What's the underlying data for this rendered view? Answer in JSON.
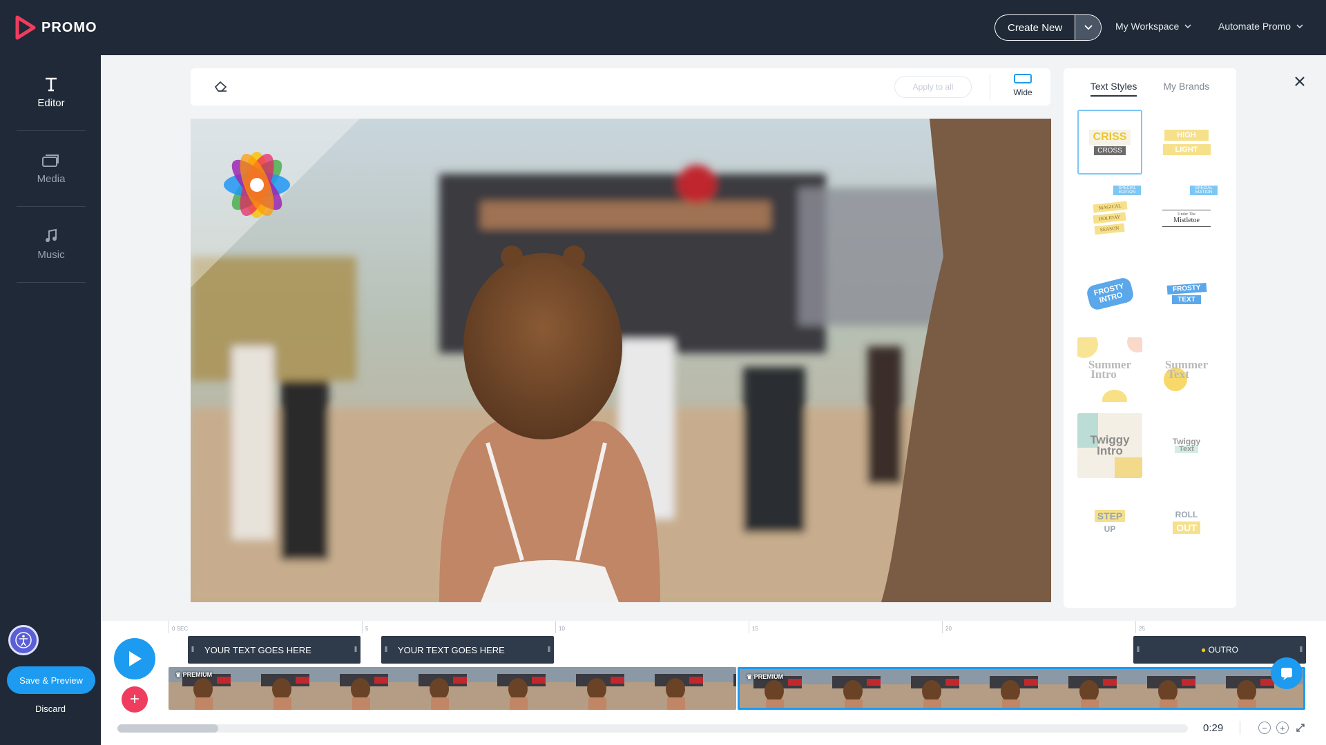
{
  "app": {
    "name": "PROMO"
  },
  "header": {
    "create_label": "Create New",
    "workspace_label": "My Workspace",
    "automate_label": "Automate Promo"
  },
  "sidebar": {
    "items": [
      {
        "label": "Editor",
        "icon": "text-icon",
        "active": true
      },
      {
        "label": "Media",
        "icon": "media-icon",
        "active": false
      },
      {
        "label": "Music",
        "icon": "music-note-icon",
        "active": false
      }
    ],
    "save_label": "Save & Preview",
    "discard_label": "Discard"
  },
  "toolbar": {
    "apply_all_label": "Apply to all",
    "layout_label": "Wide"
  },
  "styles_panel": {
    "tabs": [
      "Text Styles",
      "My Brands"
    ],
    "active_tab": "Text Styles",
    "styles": [
      {
        "line1": "CRISS",
        "line2": "CROSS"
      },
      {
        "line1": "HIGH",
        "line2": "LIGHT"
      },
      {
        "badge": "SPECIAL EDITION",
        "line1": "MAGICAL",
        "line2": "HOLIDAY",
        "line3": "SEASON"
      },
      {
        "badge": "SPECIAL EDITION",
        "line1": "Under The",
        "line2": "Mistletoe"
      },
      {
        "line1": "FROSTY",
        "line2": "INTRO"
      },
      {
        "line1": "FROSTY",
        "line2": "TEXT"
      },
      {
        "line1": "Summer",
        "line2": "Intro"
      },
      {
        "line1": "Summer",
        "line2": "Text"
      },
      {
        "line1": "Twiggy",
        "line2": "Intro"
      },
      {
        "line1": "Twiggy",
        "line2": "Text"
      },
      {
        "line1": "STEP",
        "line2": "UP"
      },
      {
        "line1": "ROLL",
        "line2": "OUT"
      }
    ]
  },
  "timeline": {
    "ruler": [
      "0 SEC",
      "5",
      "10",
      "15",
      "20",
      "25"
    ],
    "text_clips": [
      "YOUR TEXT GOES HERE",
      "YOUR TEXT GOES HERE"
    ],
    "outro_label": "OUTRO",
    "premium_label": "PREMIUM",
    "time": "0:29",
    "scroll_position": 0.094
  },
  "colors": {
    "accent": "#1d9bf0",
    "dark": "#1f2937",
    "danger": "#ef3d5f"
  }
}
